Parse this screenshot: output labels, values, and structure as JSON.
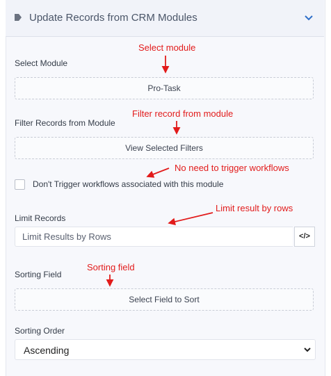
{
  "header": {
    "title": "Update Records from CRM Modules",
    "icon": "tag-icon",
    "toggle_icon": "chevron-down-icon"
  },
  "fields": {
    "select_module": {
      "label": "Select Module",
      "button": "Pro-Task"
    },
    "filter_records": {
      "label": "Filter Records from Module",
      "button": "View Selected Filters"
    },
    "no_trigger": {
      "label": "Don't Trigger workflows associated with this module",
      "checked": false
    },
    "limit_records": {
      "label": "Limit Records",
      "placeholder": "Limit Results by Rows",
      "code_button": "</>"
    },
    "sorting_field": {
      "label": "Sorting Field",
      "button": "Select Field to Sort"
    },
    "sorting_order": {
      "label": "Sorting Order",
      "selected": "Ascending"
    }
  },
  "annotations": {
    "select_module": "Select module",
    "filter_record": "Filter record from module",
    "no_trigger": "No need to trigger workflows",
    "limit": "Limit result by rows",
    "sorting": "Sorting field"
  },
  "colors": {
    "annotation": "#e21b1b",
    "panel_bg": "#f7f8fc",
    "accent": "#2f6fc9"
  }
}
